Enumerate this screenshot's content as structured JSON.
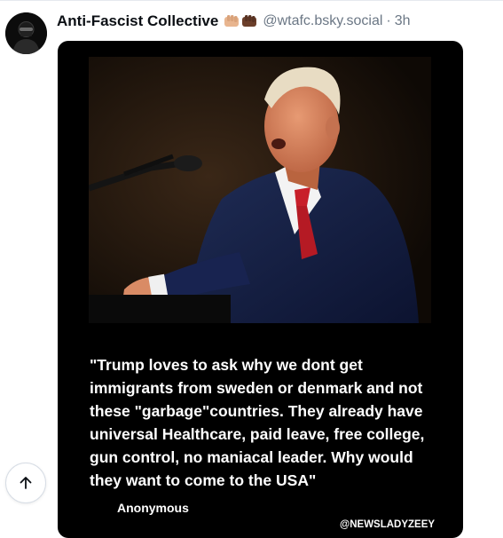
{
  "post": {
    "author": "Anti-Fascist Collective",
    "author_emoji": [
      "fist-light-icon",
      "fist-dark-icon"
    ],
    "handle": "@wtafc.bsky.social",
    "separator": "·",
    "time": "3h",
    "image": {
      "quote": "\"Trump loves to ask why we dont get immigrants from sweden or denmark and not these \"garbage\"countries. They already have universal Healthcare, paid leave, free college, gun control, no maniacal leader. Why would they want to come to the USA\"",
      "attribution": "Anonymous",
      "watermark": "@NEWSLADYZEEY"
    }
  },
  "controls": {
    "scroll_top_icon": "arrow-up-icon"
  },
  "colors": {
    "handle": "#6b7785",
    "author": "#0b0f14",
    "media_bg": "#000000"
  }
}
